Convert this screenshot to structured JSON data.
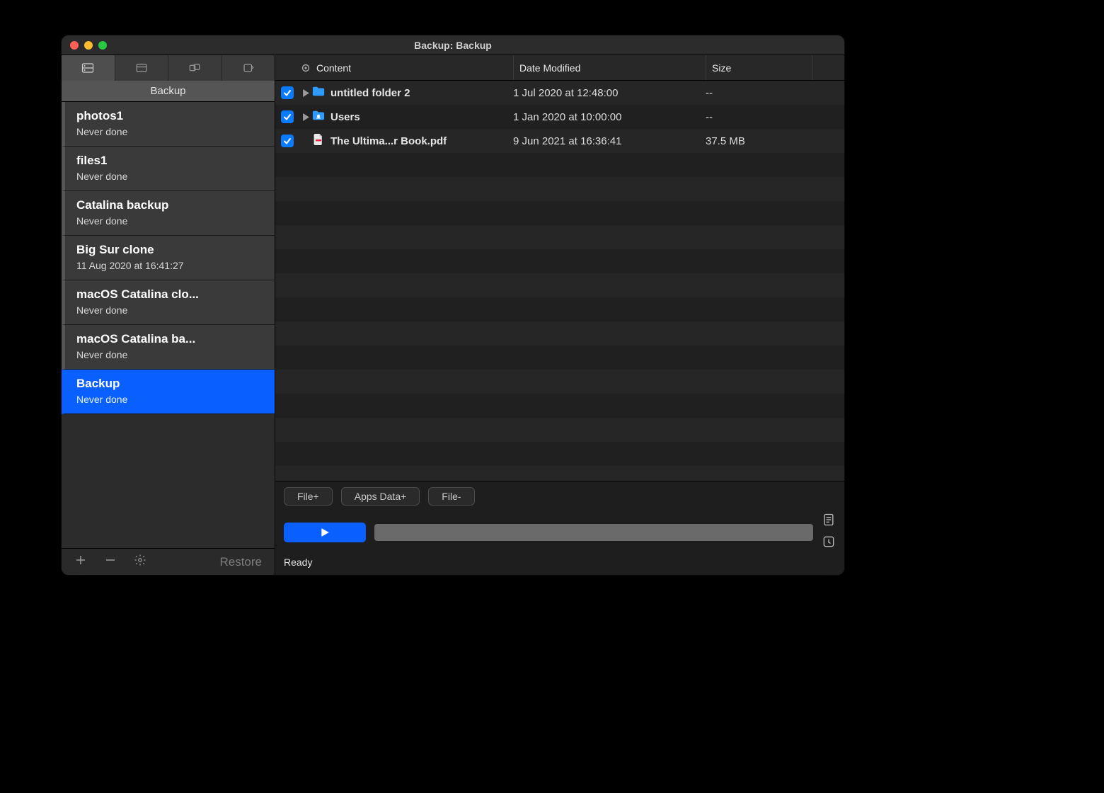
{
  "window": {
    "title": "Backup: Backup"
  },
  "sidebar": {
    "heading": "Backup",
    "items": [
      {
        "name": "photos1",
        "status": "Never done"
      },
      {
        "name": "files1",
        "status": "Never done"
      },
      {
        "name": "Catalina backup",
        "status": "Never done"
      },
      {
        "name": "Big Sur clone",
        "status": "11 Aug 2020 at 16:41:27"
      },
      {
        "name": "macOS Catalina clo...",
        "status": "Never done"
      },
      {
        "name": "macOS Catalina ba...",
        "status": "Never done"
      },
      {
        "name": "Backup",
        "status": "Never done"
      }
    ],
    "selected_index": 6,
    "footer": {
      "restore_label": "Restore"
    }
  },
  "columns": {
    "content": "Content",
    "date": "Date Modified",
    "size": "Size"
  },
  "rows": [
    {
      "checked": true,
      "expandable": true,
      "icon": "folder",
      "name": "untitled folder 2",
      "date": "1 Jul 2020 at 12:48:00",
      "size": "--"
    },
    {
      "checked": true,
      "expandable": true,
      "icon": "folder-users",
      "name": "Users",
      "date": "1 Jan 2020 at 10:00:00",
      "size": "--"
    },
    {
      "checked": true,
      "expandable": false,
      "icon": "pdf",
      "name": "The Ultima...r Book.pdf",
      "date": "9 Jun 2021 at 16:36:41",
      "size": "37.5 MB"
    }
  ],
  "buttons": {
    "file_add": "File+",
    "apps_data_add": "Apps Data+",
    "file_remove": "File-"
  },
  "status": "Ready",
  "colors": {
    "accent": "#0a60ff"
  }
}
